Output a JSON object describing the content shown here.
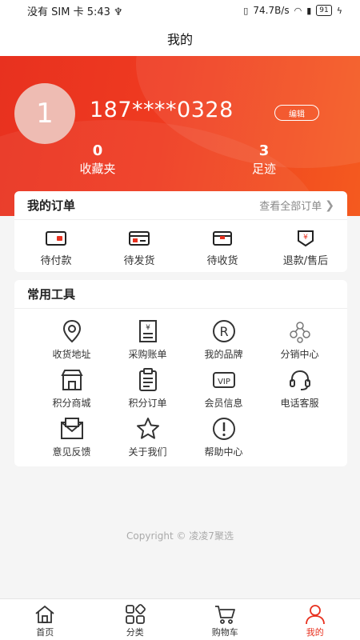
{
  "status_bar": {
    "left_text": "没有 SIM 卡 5:43 ♆",
    "speed": "74.7B/s",
    "battery": "91"
  },
  "title": "我的",
  "profile": {
    "avatar_text": "1",
    "phone": "187****0328",
    "edit_label": "编辑",
    "favorites_count": "0",
    "favorites_label": "收藏夹",
    "footprint_count": "3",
    "footprint_label": "足迹"
  },
  "orders": {
    "title": "我的订单",
    "view_all": "查看全部订单",
    "items": [
      {
        "label": "待付款",
        "icon": "wallet-icon"
      },
      {
        "label": "待发货",
        "icon": "card-icon"
      },
      {
        "label": "待收货",
        "icon": "box-icon"
      },
      {
        "label": "退款/售后",
        "icon": "refund-icon"
      }
    ]
  },
  "tools": {
    "title": "常用工具",
    "items": [
      {
        "label": "收货地址",
        "icon": "location-icon"
      },
      {
        "label": "采购账单",
        "icon": "bill-icon"
      },
      {
        "label": "我的品牌",
        "icon": "registered-icon"
      },
      {
        "label": "分销中心",
        "icon": "network-icon"
      },
      {
        "label": "积分商城",
        "icon": "store-icon"
      },
      {
        "label": "积分订单",
        "icon": "clipboard-icon"
      },
      {
        "label": "会员信息",
        "icon": "vip-icon"
      },
      {
        "label": "电话客服",
        "icon": "headset-icon"
      },
      {
        "label": "意见反馈",
        "icon": "mail-icon"
      },
      {
        "label": "关于我们",
        "icon": "star-icon"
      },
      {
        "label": "帮助中心",
        "icon": "help-icon"
      }
    ]
  },
  "copyright": "Copyright © 凌凌7聚选",
  "tabbar": {
    "items": [
      {
        "label": "首页",
        "icon": "home-icon"
      },
      {
        "label": "分类",
        "icon": "category-icon"
      },
      {
        "label": "购物车",
        "icon": "cart-icon"
      },
      {
        "label": "我的",
        "icon": "user-icon",
        "active": true
      }
    ]
  },
  "colors": {
    "accent": "#e8311f",
    "gradient_end": "#f45a1f"
  }
}
